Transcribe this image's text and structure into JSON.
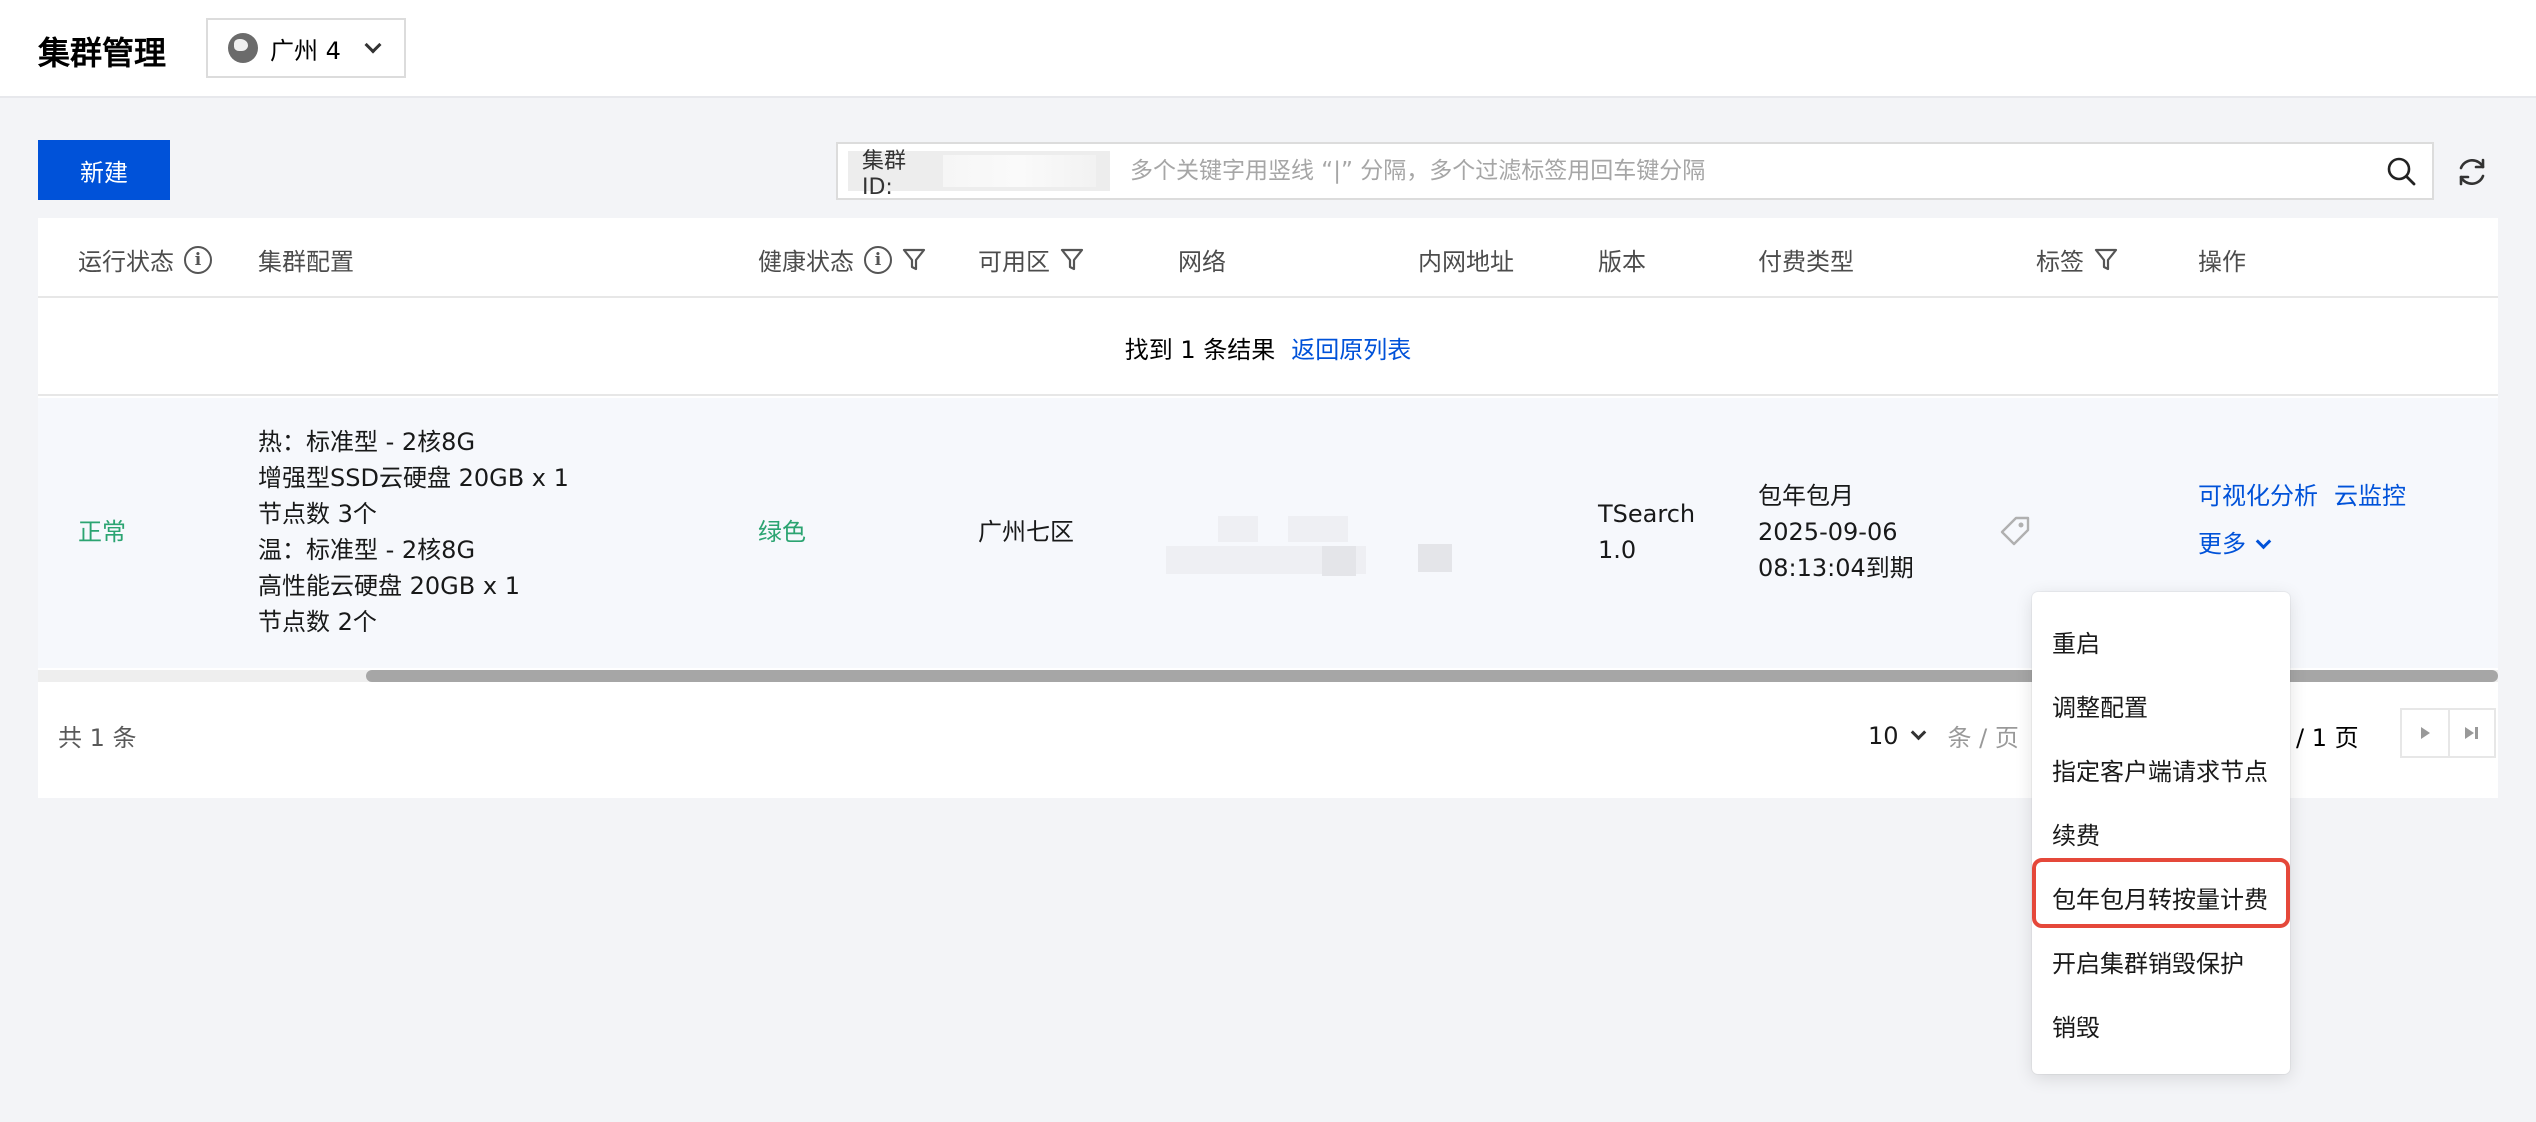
{
  "header": {
    "title": "集群管理",
    "region_label": "广州 4"
  },
  "toolbar": {
    "new_button": "新建",
    "search_tag_label": "集群ID:",
    "search_placeholder": "多个关键字用竖线 “|” 分隔，多个过滤标签用回车键分隔"
  },
  "table": {
    "columns": {
      "status": "运行状态",
      "config": "集群配置",
      "health": "健康状态",
      "zone": "可用区",
      "network": "网络",
      "ip": "内网地址",
      "version": "版本",
      "billing": "付费类型",
      "tags": "标签",
      "actions": "操作"
    },
    "result_text": "找到 1 条结果",
    "result_back_link": "返回原列表",
    "row": {
      "status": "正常",
      "config_lines": [
        "热：标准型 - 2核8G",
        "增强型SSD云硬盘 20GB x 1",
        "节点数 3个",
        "温：标准型 - 2核8G",
        "高性能云硬盘 20GB x 1",
        "节点数 2个"
      ],
      "health": "绿色",
      "zone": "广州七区",
      "version_lines": [
        "TSearch",
        "1.0"
      ],
      "billing_lines": [
        "包年包月",
        "2025-09-06",
        "08:13:04到期"
      ],
      "action_visualize": "可视化分析",
      "action_monitor": "云监控",
      "action_more": "更多"
    }
  },
  "pagination": {
    "total": "共 1 条",
    "page_size": "10",
    "page_size_unit": "条 / 页",
    "page_count": "/ 1 页"
  },
  "more_menu": {
    "items": [
      "重启",
      "调整配置",
      "指定客户端请求节点",
      "续费",
      "包年包月转按量计费",
      "开启集群销毁保护",
      "销毁"
    ],
    "highlight_color": "#e5483a"
  },
  "colors": {
    "primary": "#0052d9",
    "success": "#2ba471"
  }
}
